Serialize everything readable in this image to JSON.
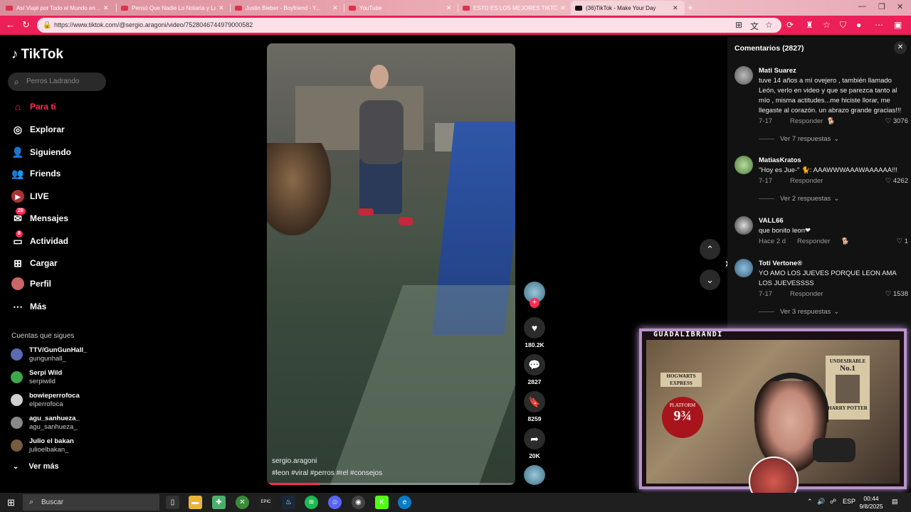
{
  "browser": {
    "tabs": [
      {
        "label": "Así Viajé por Todo el Mundo en ..."
      },
      {
        "label": "Pensó Que Nadie Lo Notaría y La..."
      },
      {
        "label": "Justin Bieber - Boyfriend - Y..."
      },
      {
        "label": "YouTube"
      },
      {
        "label": "ESTO ES LOS MEJORES TIKTOKS ..."
      },
      {
        "label": "(36)TikTok - Make Your Day"
      }
    ],
    "url": "https://www.tiktok.com/@sergio.aragoni/video/7528046744979000582"
  },
  "sidebar": {
    "logo": "TikTok",
    "search_placeholder": "Perros Ladrando",
    "nav": [
      {
        "label": "Para ti",
        "icon": "home-icon"
      },
      {
        "label": "Explorar",
        "icon": "compass-icon"
      },
      {
        "label": "Siguiendo",
        "icon": "user-follow-icon"
      },
      {
        "label": "Friends",
        "icon": "friends-icon"
      },
      {
        "label": "LIVE",
        "icon": "live-icon"
      },
      {
        "label": "Mensajes",
        "icon": "message-icon",
        "badge": "28"
      },
      {
        "label": "Actividad",
        "icon": "activity-icon",
        "badge": "8"
      },
      {
        "label": "Cargar",
        "icon": "upload-icon"
      },
      {
        "label": "Perfil",
        "icon": "profile-icon"
      },
      {
        "label": "Más",
        "icon": "more-icon"
      }
    ],
    "following_title": "Cuentas que sigues",
    "following": [
      {
        "name": "TTV/GunGunHall_",
        "handle": "gungunhall_"
      },
      {
        "name": "Serpi Wild",
        "handle": "serpiwild"
      },
      {
        "name": "bowieperrofoca",
        "handle": "elperrofoca"
      },
      {
        "name": "agu_sanhueza_",
        "handle": "agu_sanhueza_"
      },
      {
        "name": "Julio el bakan",
        "handle": "julioelbakan_"
      }
    ],
    "see_more": "Ver más"
  },
  "video": {
    "author": "sergio.aragoni",
    "tags": "#leon #viral #perros #rel #consejos",
    "progress": 0.21
  },
  "actions": {
    "likes": "180.2K",
    "comments": "2827",
    "saves": "8259",
    "shares": "20K"
  },
  "comments": {
    "header": "Comentarios (2827)",
    "items": [
      {
        "user": "Mati Suarez",
        "text": "tuve 14 años a mí ovejero , también llamado León, verlo en video y que se parezca tanto al mío , misma actitudes...me hiciste llorar, me llegaste al corazón. un abrazo grande gracias!!!",
        "date": "7-17",
        "reply": "Responder",
        "likes": "3076",
        "more": "Ver 7 respuestas"
      },
      {
        "user": "MatiasKratos",
        "text": "\"Hoy es Jue-\" 🐈: AAAWWWAAAWAAAAAA!!!",
        "date": "7-17",
        "reply": "Responder",
        "likes": "4262",
        "more": "Ver 2 respuestas"
      },
      {
        "user": "VALL66",
        "text": "que bonito leon❤",
        "date": "Hace 2 d",
        "reply": "Responder",
        "likes": "1"
      },
      {
        "user": "Toti Vertone®",
        "text": "YO AMO LOS JUEVES PORQUE LEON AMA LOS JUEVESSSS",
        "date": "7-17",
        "reply": "Responder",
        "likes": "1538",
        "more": "Ver 3 respuestas"
      }
    ]
  },
  "webcam": {
    "name": "GUADALIBRANDI",
    "poster_title": "UNDESIRABLE",
    "poster_no": "No.1",
    "poster_name": "HARRY POTTER",
    "sign": "HOGWARTS EXPRESS",
    "platform_word": "PLATFORM",
    "platform_num": "9¾"
  },
  "taskbar": {
    "search": "Buscar",
    "lang": "ESP",
    "time": "00:44",
    "date": "9/8/2025"
  },
  "colors": {
    "accent": "#fe2c55",
    "address_bar": "#ec1f58",
    "tabstrip": "#e8a3ae"
  }
}
